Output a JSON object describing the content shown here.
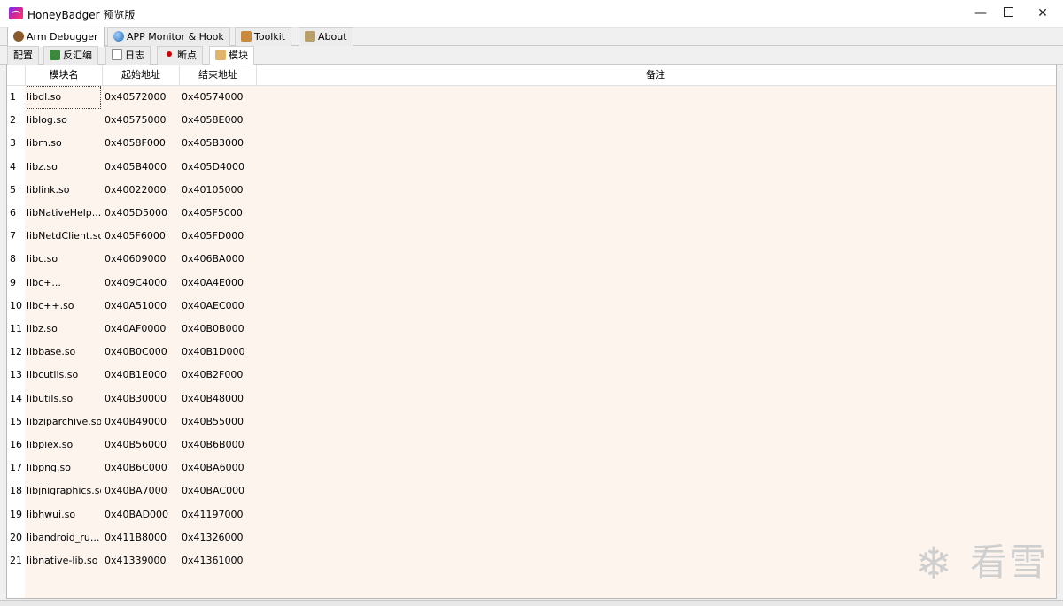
{
  "window": {
    "title": "HoneyBadger 预览版",
    "minimize": "—",
    "close": "✕"
  },
  "main_tabs": [
    {
      "label": "Arm Debugger",
      "icon": "badger-icon"
    },
    {
      "label": "APP Monitor & Hook",
      "icon": "globe-icon"
    },
    {
      "label": "Toolkit",
      "icon": "toolbox-icon"
    },
    {
      "label": "About",
      "icon": "info-icon"
    }
  ],
  "sub_tabs": [
    {
      "label": "配置"
    },
    {
      "label": "反汇编",
      "icon": "disasm-icon"
    },
    {
      "label": "日志",
      "icon": "log-icon"
    },
    {
      "label": "断点",
      "icon": "breakpoint-icon"
    },
    {
      "label": "模块",
      "icon": "module-icon"
    }
  ],
  "table": {
    "columns": [
      "模块名",
      "起始地址",
      "结束地址",
      "备注"
    ],
    "rows": [
      {
        "num": "1",
        "name": "libdl.so",
        "start": "0x40572000",
        "end": "0x40574000",
        "note": ""
      },
      {
        "num": "2",
        "name": "liblog.so",
        "start": "0x40575000",
        "end": "0x4058E000",
        "note": ""
      },
      {
        "num": "3",
        "name": "libm.so",
        "start": "0x4058F000",
        "end": "0x405B3000",
        "note": ""
      },
      {
        "num": "4",
        "name": "libz.so",
        "start": "0x405B4000",
        "end": "0x405D4000",
        "note": ""
      },
      {
        "num": "5",
        "name": "liblink.so",
        "start": "0x40022000",
        "end": "0x40105000",
        "note": ""
      },
      {
        "num": "6",
        "name": "libNativeHelp...",
        "start": "0x405D5000",
        "end": "0x405F5000",
        "note": ""
      },
      {
        "num": "7",
        "name": "libNetdClient.so",
        "start": "0x405F6000",
        "end": "0x405FD000",
        "note": ""
      },
      {
        "num": "8",
        "name": "libc.so",
        "start": "0x40609000",
        "end": "0x406BA000",
        "note": ""
      },
      {
        "num": "9",
        "name": "libc+...",
        "start": "0x409C4000",
        "end": "0x40A4E000",
        "note": ""
      },
      {
        "num": "10",
        "name": "libc++.so",
        "start": "0x40A51000",
        "end": "0x40AEC000",
        "note": ""
      },
      {
        "num": "11",
        "name": "libz.so",
        "start": "0x40AF0000",
        "end": "0x40B0B000",
        "note": ""
      },
      {
        "num": "12",
        "name": "libbase.so",
        "start": "0x40B0C000",
        "end": "0x40B1D000",
        "note": ""
      },
      {
        "num": "13",
        "name": "libcutils.so",
        "start": "0x40B1E000",
        "end": "0x40B2F000",
        "note": ""
      },
      {
        "num": "14",
        "name": "libutils.so",
        "start": "0x40B30000",
        "end": "0x40B48000",
        "note": ""
      },
      {
        "num": "15",
        "name": "libziparchive.so",
        "start": "0x40B49000",
        "end": "0x40B55000",
        "note": ""
      },
      {
        "num": "16",
        "name": "libpiex.so",
        "start": "0x40B56000",
        "end": "0x40B6B000",
        "note": ""
      },
      {
        "num": "17",
        "name": "libpng.so",
        "start": "0x40B6C000",
        "end": "0x40BA6000",
        "note": ""
      },
      {
        "num": "18",
        "name": "libjnigraphics.so",
        "start": "0x40BA7000",
        "end": "0x40BAC000",
        "note": ""
      },
      {
        "num": "19",
        "name": "libhwui.so",
        "start": "0x40BAD000",
        "end": "0x41197000",
        "note": ""
      },
      {
        "num": "20",
        "name": "libandroid_ru...",
        "start": "0x411B8000",
        "end": "0x41326000",
        "note": ""
      },
      {
        "num": "21",
        "name": "libnative-lib.so",
        "start": "0x41339000",
        "end": "0x41361000",
        "note": ""
      }
    ]
  },
  "watermark": {
    "text": "看雪",
    "icon": "snowflake-icon",
    "glyph": "❄"
  },
  "colors": {
    "table_bg": "#fdf4ee",
    "app_icon": "#d7268e",
    "breakpoint": "#cc0000"
  }
}
